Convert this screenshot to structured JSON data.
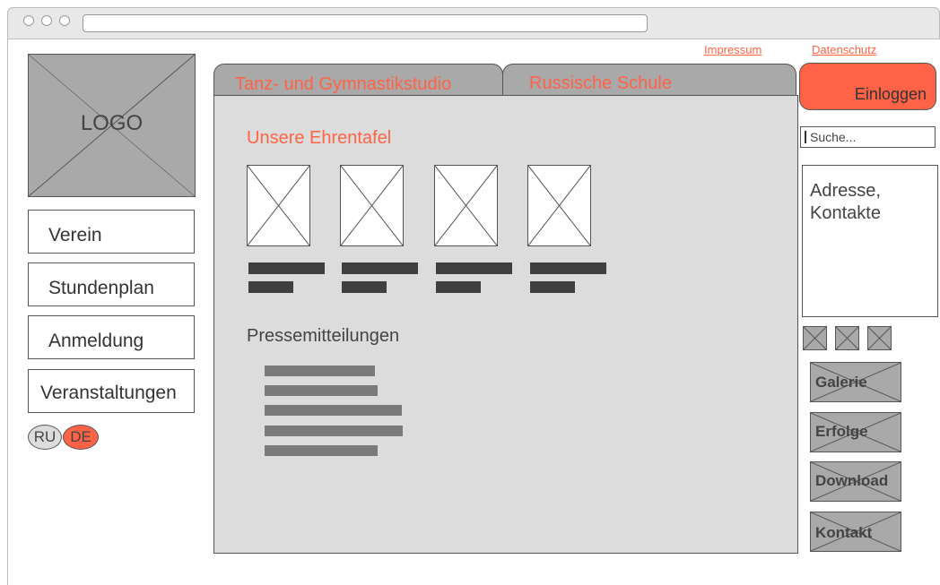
{
  "header": {
    "links": {
      "impressum": "Impressum",
      "datenschutz": "Datenschutz"
    }
  },
  "logo": {
    "label": "LOGO"
  },
  "sidebar": {
    "items": [
      {
        "label": "Verein"
      },
      {
        "label": "Stundenplan"
      },
      {
        "label": "Anmeldung"
      },
      {
        "label": "Veranstaltungen"
      }
    ],
    "languages": {
      "ru": "RU",
      "de": "DE",
      "active": "DE"
    }
  },
  "tabs": [
    {
      "label": "Tanz- und Gymnastikstudio"
    },
    {
      "label": "Russische Schule"
    }
  ],
  "main": {
    "honor_title": "Unsere Ehrentafel",
    "press_title": "Pressemitteilungen"
  },
  "right": {
    "login_label": "Einloggen",
    "search_placeholder": "Suche...",
    "address_text": "Adresse, Kontakte",
    "buttons": [
      {
        "label": "Galerie"
      },
      {
        "label": "Erfolge"
      },
      {
        "label": "Download"
      },
      {
        "label": "Kontakt"
      }
    ]
  },
  "colors": {
    "accent": "#ff6347",
    "panel": "#dcdcdc",
    "placeholder": "#a9a9a9"
  },
  "icons": [
    "image-placeholder-icon",
    "social-icon"
  ]
}
